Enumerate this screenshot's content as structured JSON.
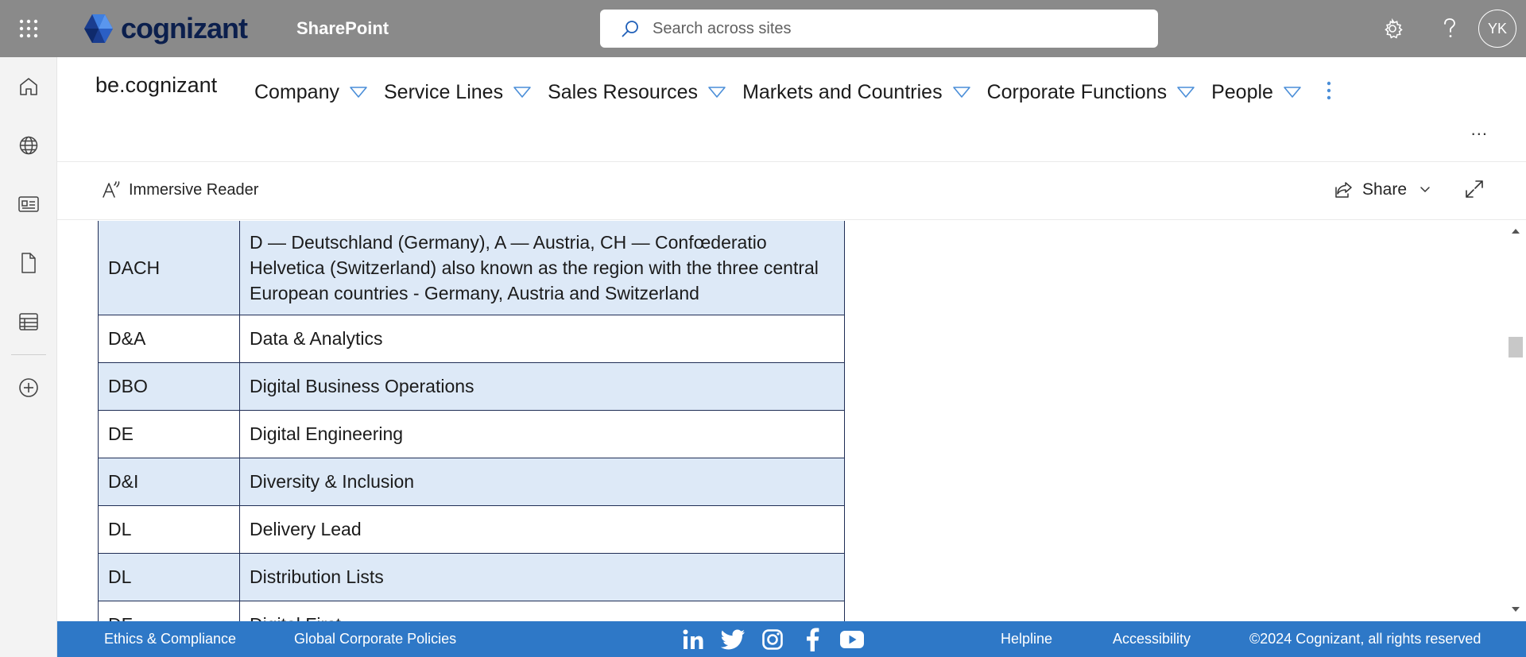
{
  "suite": {
    "brand": "cognizant",
    "app_name": "SharePoint",
    "search_placeholder": "Search across sites",
    "avatar_initials": "YK"
  },
  "site": {
    "title": "be.cognizant",
    "nav": [
      {
        "label": "Company"
      },
      {
        "label": "Service Lines"
      },
      {
        "label": "Sales Resources"
      },
      {
        "label": "Markets and Countries"
      },
      {
        "label": "Corporate Functions"
      },
      {
        "label": "People"
      }
    ],
    "more_label": "..."
  },
  "commandbar": {
    "immersive_reader": "Immersive Reader",
    "share": "Share"
  },
  "table": {
    "rows": [
      {
        "abbr": "DACH",
        "meaning": "D — Deutschland (Germany), A — Austria, CH — Confœderatio Helvetica (Switzerland) also known as the region with the three central European countries - Germany, Austria and Switzerland"
      },
      {
        "abbr": "D&A",
        "meaning": "Data & Analytics"
      },
      {
        "abbr": "DBO",
        "meaning": "Digital Business Operations"
      },
      {
        "abbr": "DE",
        "meaning": "Digital Engineering"
      },
      {
        "abbr": "D&I",
        "meaning": "Diversity & Inclusion"
      },
      {
        "abbr": "DL",
        "meaning": "Delivery Lead"
      },
      {
        "abbr": "DL",
        "meaning": "Distribution Lists"
      },
      {
        "abbr": "DF",
        "meaning": "Digital First"
      }
    ]
  },
  "footer": {
    "ethics": "Ethics & Compliance",
    "policies": "Global Corporate Policies",
    "helpline": "Helpline",
    "accessibility": "Accessibility",
    "copyright": "©2024 Cognizant, all rights reserved"
  },
  "colors": {
    "suitebar": "#8a8a8a",
    "footer": "#2e78c7",
    "row_shade": "#dde9f7",
    "table_border": "#1f2d55",
    "accent": "#2e78c7"
  }
}
